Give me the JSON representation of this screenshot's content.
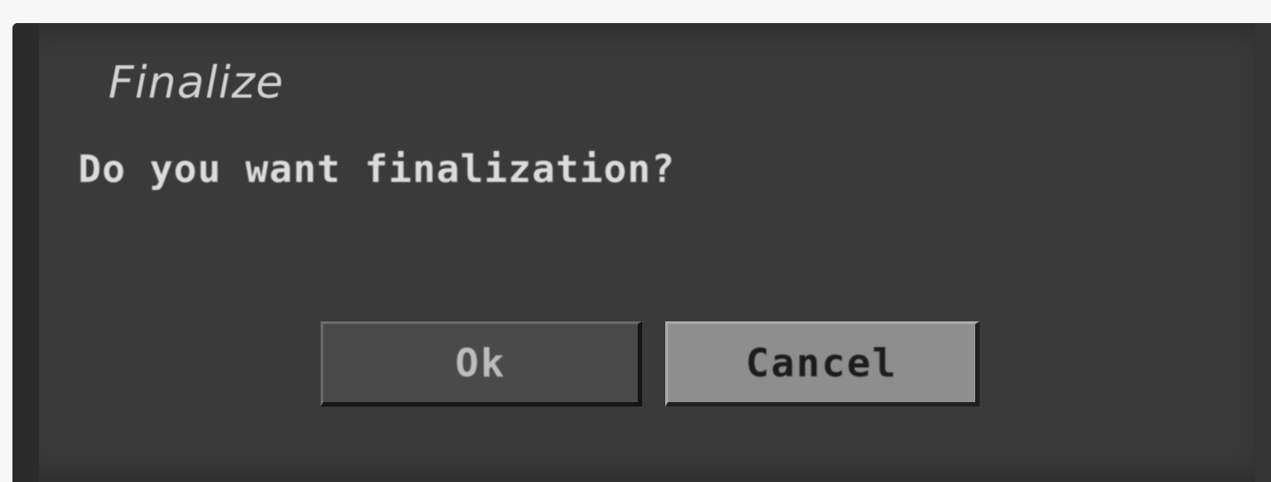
{
  "dialog": {
    "title": "Finalize",
    "message": "Do you want finalization?",
    "buttons": {
      "ok_label": "Ok",
      "cancel_label": "Cancel"
    },
    "selected_button": "Cancel"
  },
  "colors": {
    "dialog_background": "#3a3a3a",
    "text": "#dcdcdc",
    "button_normal": "#4a4a4a",
    "button_selected": "#8e8e8e"
  }
}
